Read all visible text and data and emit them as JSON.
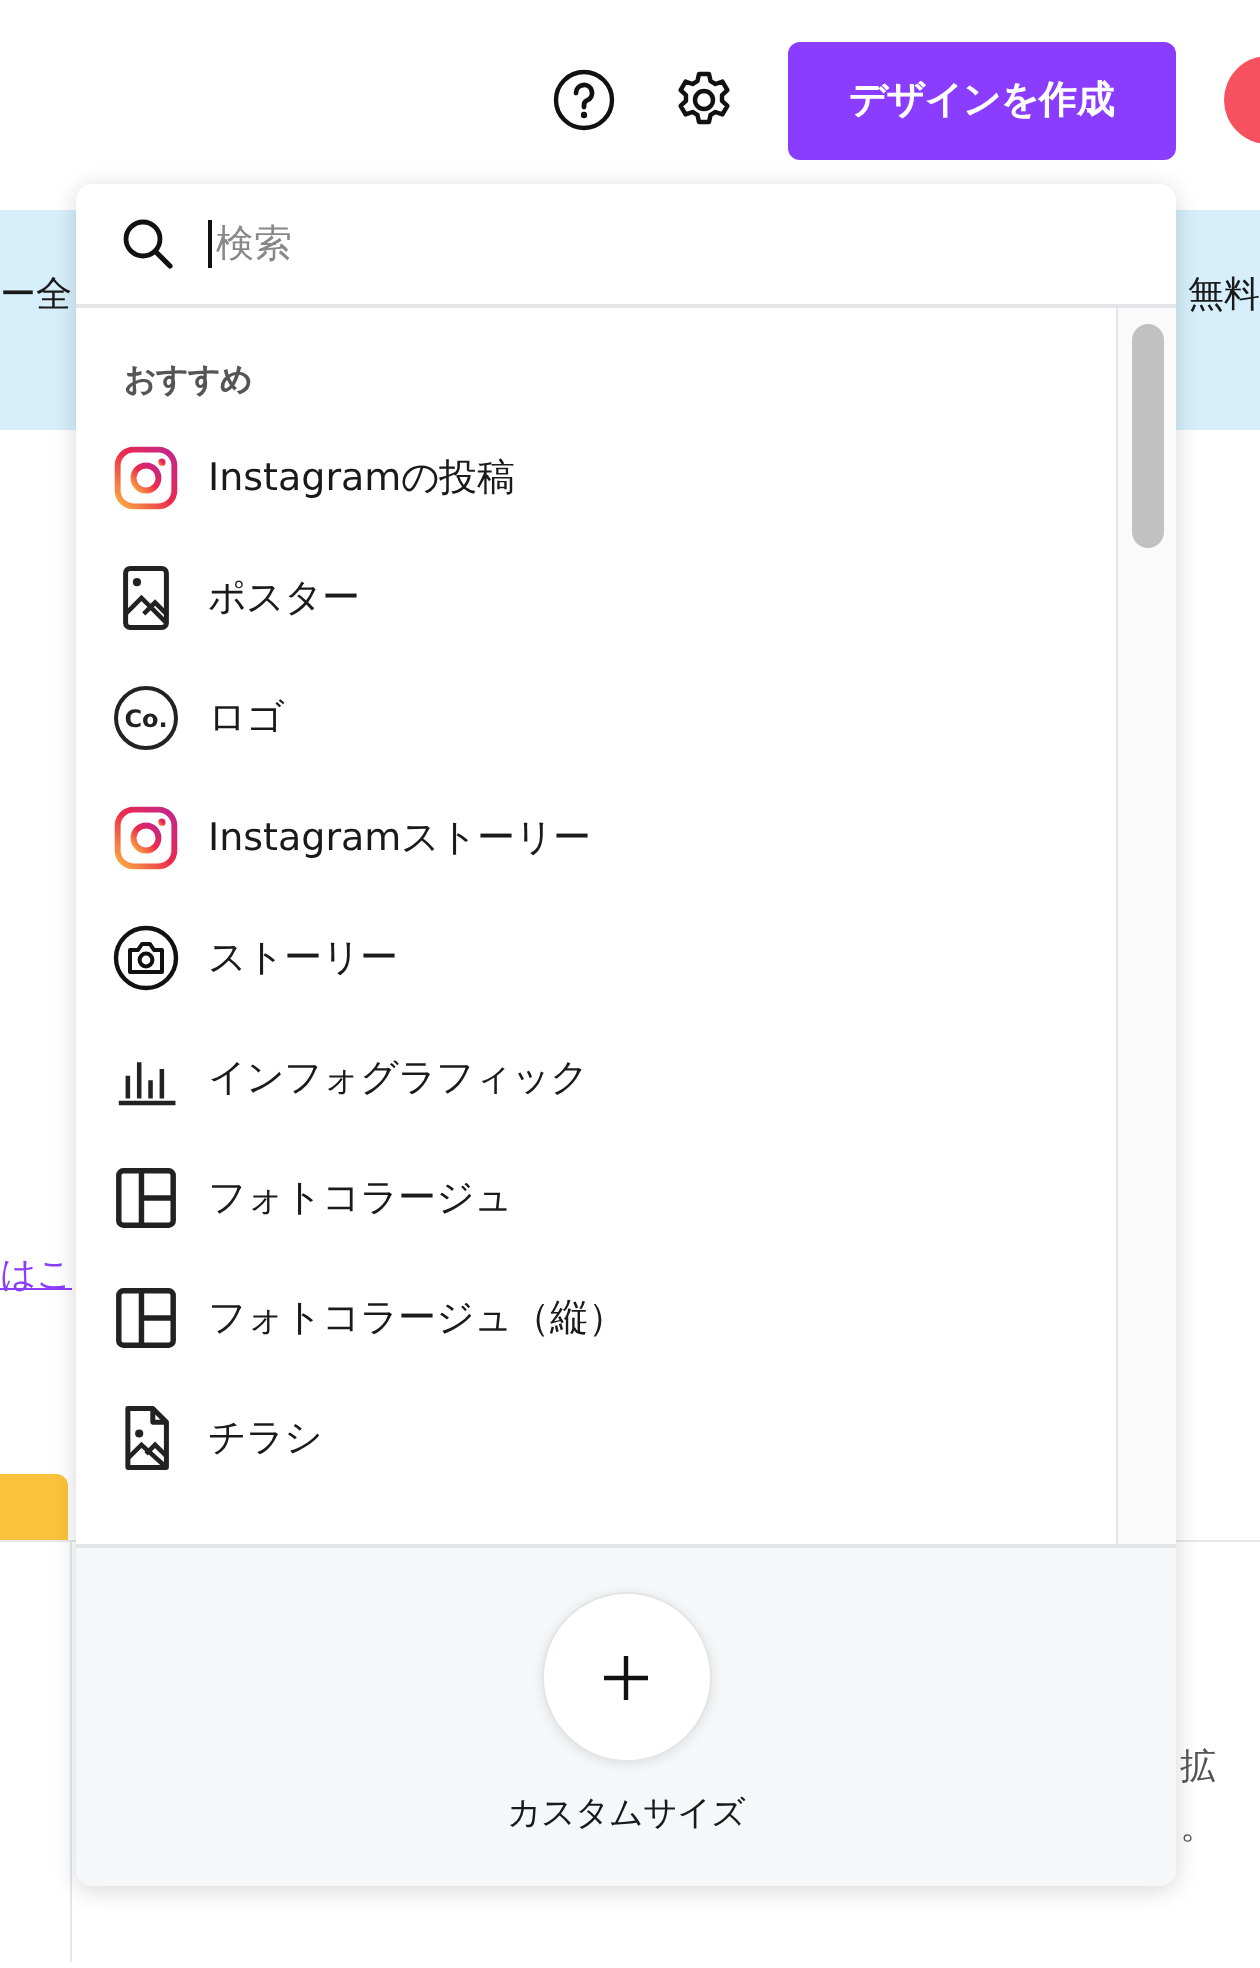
{
  "header": {
    "create_button": "デザインを作成"
  },
  "banner": {
    "left_text": "ー全",
    "right_text": "無料"
  },
  "background": {
    "link": "はこ",
    "right_texts": [
      "拡",
      "。"
    ]
  },
  "dropdown": {
    "search": {
      "placeholder": "検索"
    },
    "section_title": "おすすめ",
    "items": [
      {
        "kind": "instagram",
        "label": "Instagramの投稿"
      },
      {
        "kind": "poster",
        "label": "ポスター"
      },
      {
        "kind": "logo",
        "label": "ロゴ",
        "icon_text": "Co."
      },
      {
        "kind": "instagram",
        "label": "Instagramストーリー"
      },
      {
        "kind": "camera",
        "label": "ストーリー"
      },
      {
        "kind": "chart",
        "label": "インフォグラフィック"
      },
      {
        "kind": "collage",
        "label": "フォトコラージュ"
      },
      {
        "kind": "collage",
        "label": "フォトコラージュ（縦）"
      },
      {
        "kind": "flyer",
        "label": "チラシ"
      }
    ],
    "custom": {
      "label": "カスタムサイズ"
    }
  }
}
